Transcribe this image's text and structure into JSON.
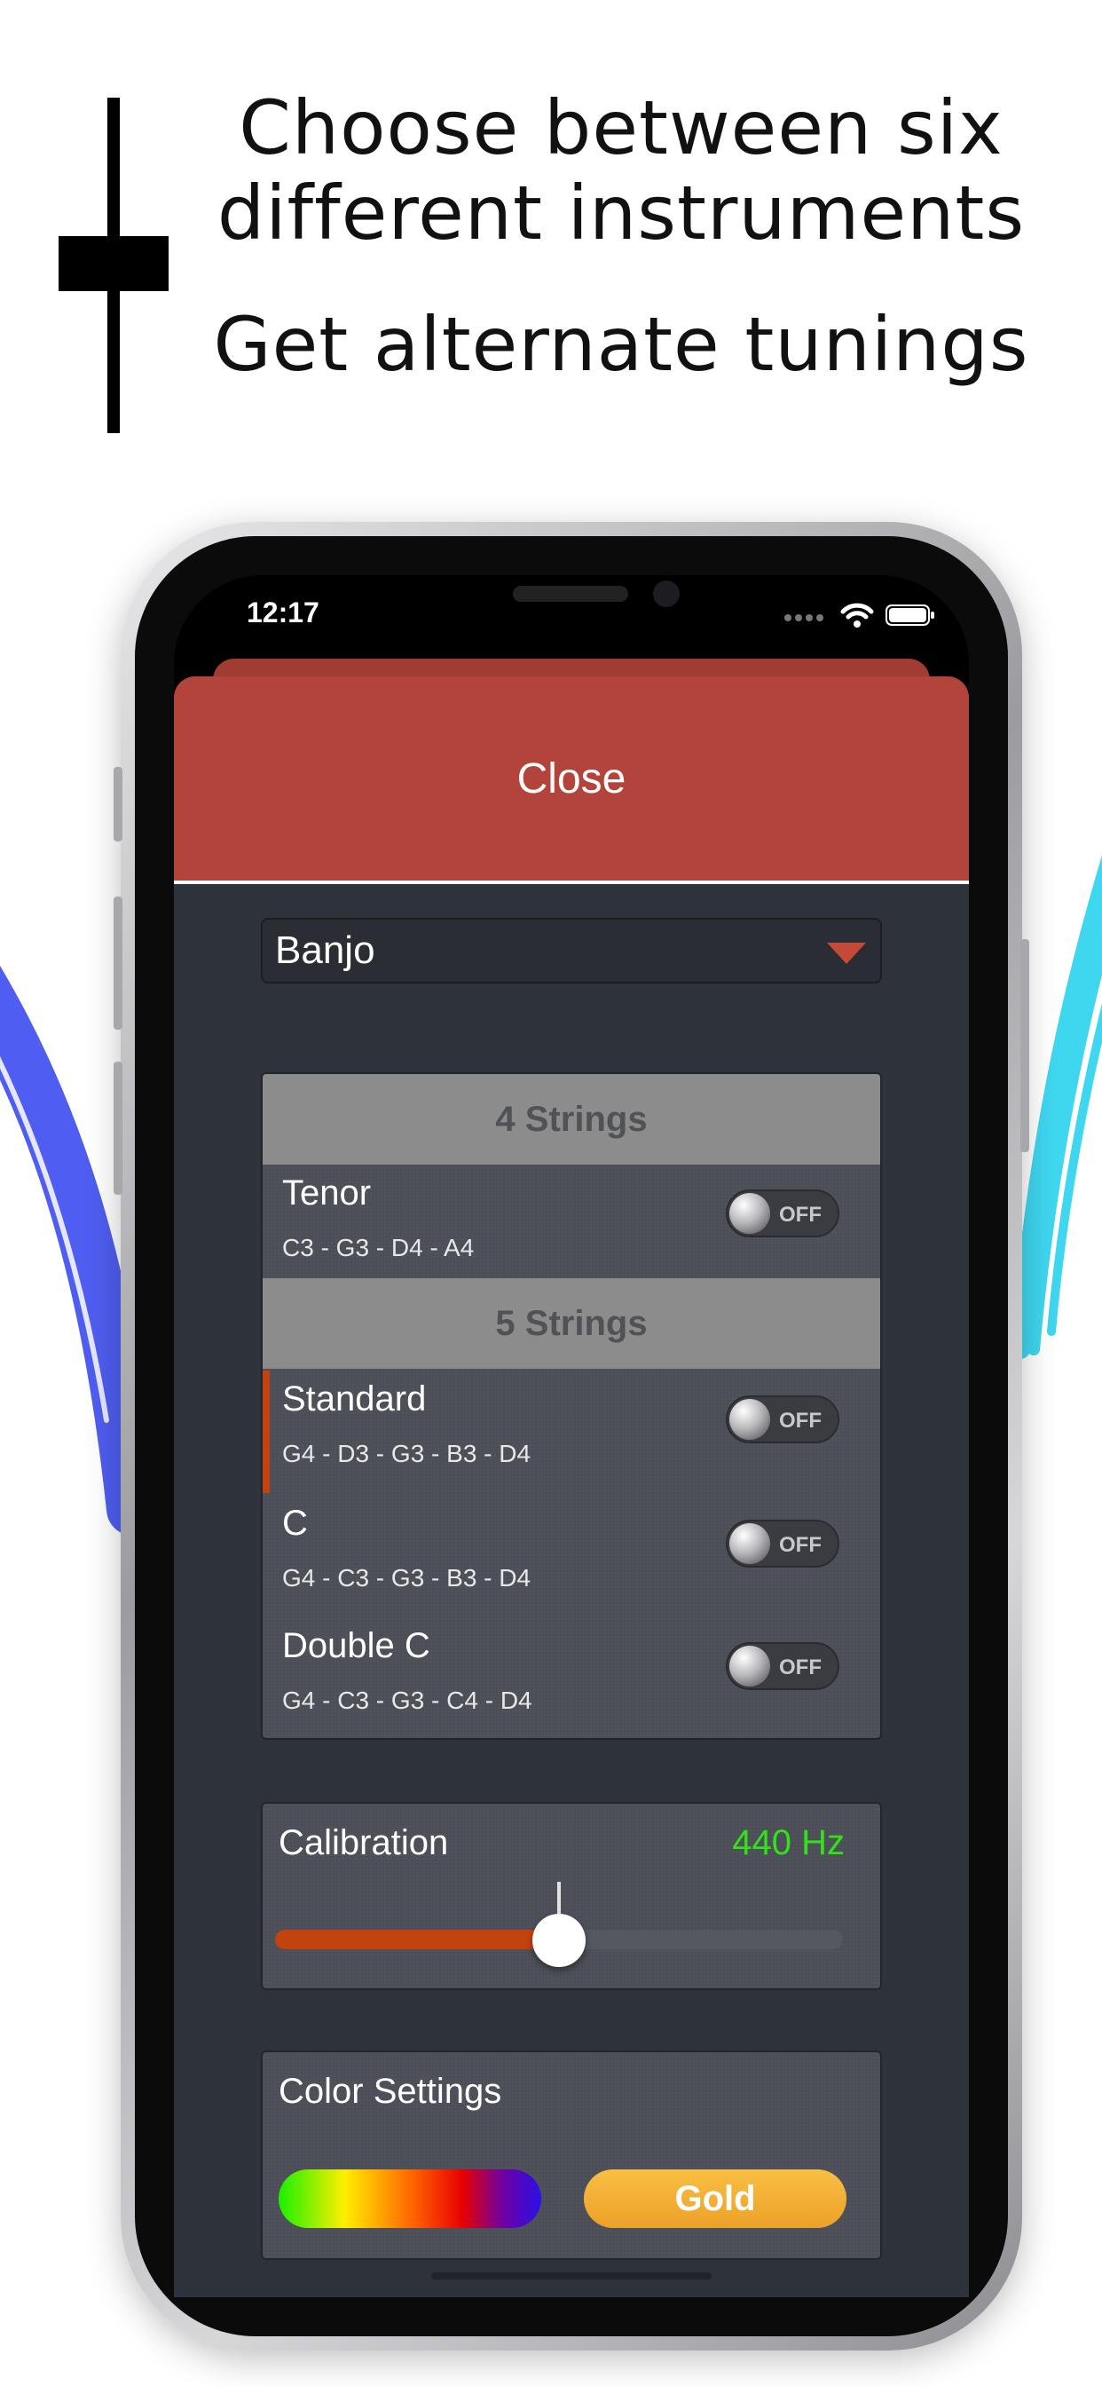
{
  "marketing": {
    "headline_line1": "Choose between six",
    "headline_line2": "different instruments",
    "headline_line3": "Get alternate tunings"
  },
  "status_bar": {
    "time": "12:17"
  },
  "sheet": {
    "close_label": "Close",
    "instrument_dropdown": {
      "selected": "Banjo"
    },
    "tuning_groups": [
      {
        "header": "4 Strings",
        "tunings": [
          {
            "name": "Tenor",
            "notes": "C3 - G3 - D4 - A4",
            "toggle": "OFF",
            "active": false
          }
        ]
      },
      {
        "header": "5 Strings",
        "tunings": [
          {
            "name": "Standard",
            "notes": "G4 - D3 - G3 - B3 - D4",
            "toggle": "OFF",
            "active": true
          },
          {
            "name": "C",
            "notes": "G4 - C3 - G3 - B3 - D4",
            "toggle": "OFF",
            "active": false
          },
          {
            "name": "Double C",
            "notes": "G4 - C3 - G3 - C4 - D4",
            "toggle": "OFF",
            "active": false
          }
        ]
      }
    ],
    "calibration": {
      "label": "Calibration",
      "value": "440 Hz",
      "slider_fraction": 0.5
    },
    "color_settings": {
      "label": "Color Settings",
      "theme_button": "Gold"
    }
  },
  "colors": {
    "close_bar": "#b3443b",
    "accent": "#c2430e",
    "calibration_value": "#31e21a",
    "gold": "#eda128",
    "panel_bg": "#4c4f58",
    "sheet_bg": "#2e323a"
  }
}
